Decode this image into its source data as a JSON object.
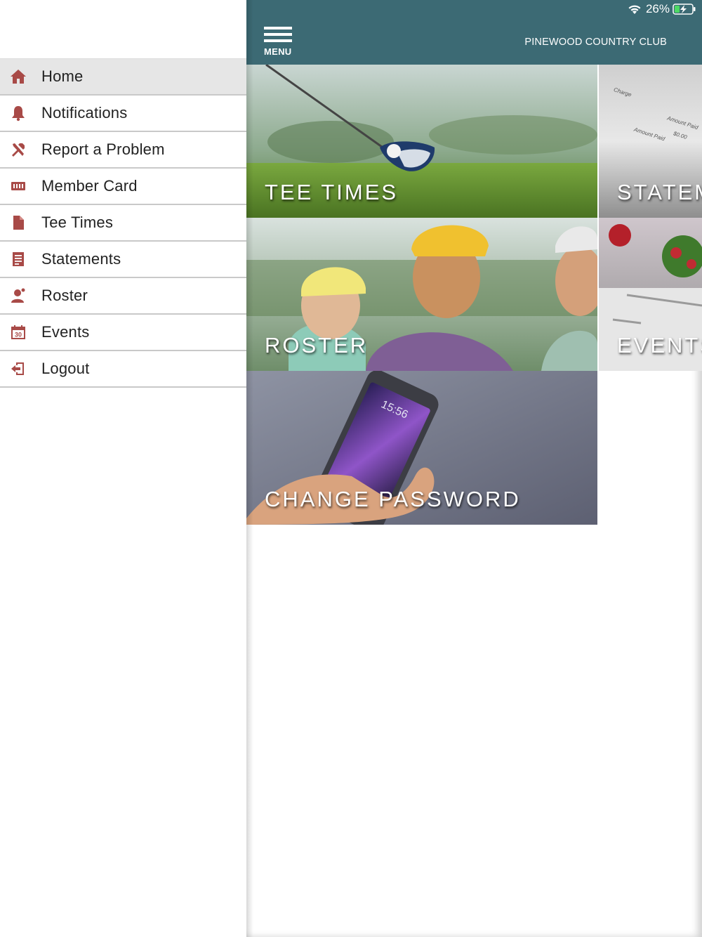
{
  "status_bar": {
    "battery": "26%"
  },
  "header": {
    "menu_label": "MENU",
    "club_name": "PINEWOOD COUNTRY CLUB"
  },
  "sidebar": {
    "items": [
      {
        "label": "Home",
        "icon": "home-icon",
        "active": true
      },
      {
        "label": "Notifications",
        "icon": "bell-icon"
      },
      {
        "label": "Report a Problem",
        "icon": "tools-icon"
      },
      {
        "label": "Member Card",
        "icon": "card-icon"
      },
      {
        "label": "Tee Times",
        "icon": "document-icon"
      },
      {
        "label": "Statements",
        "icon": "statement-icon"
      },
      {
        "label": "Roster",
        "icon": "person-icon"
      },
      {
        "label": "Events",
        "icon": "calendar-icon"
      },
      {
        "label": "Logout",
        "icon": "logout-icon"
      }
    ]
  },
  "tiles": {
    "tee_times": "TEE TIMES",
    "statements": "STATEM",
    "roster": "ROSTER",
    "events": "EVENTS",
    "change_password": "CHANGE PASSWORD"
  },
  "statement_image": {
    "line1": "Charge",
    "line2": "Amount Paid",
    "line3": "$0.00",
    "line4": "Amount Paid"
  },
  "phone_image": {
    "time": "15:56"
  },
  "colors": {
    "accent": "#3c6a74",
    "icon": "#a84a47",
    "active_bg": "#e6e6e6"
  }
}
